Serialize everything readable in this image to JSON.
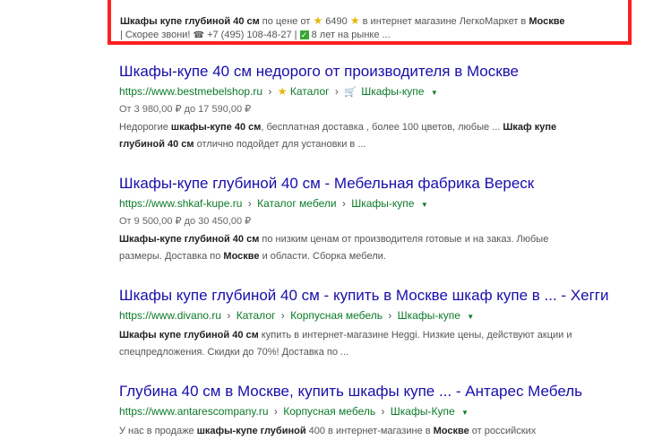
{
  "ad": {
    "line1": {
      "b1": "Шкафы купе глубиной 40 см",
      "t1": " по цене от ",
      "price": "6490",
      "t2": " в интернет магазине ЛегкоМаркет в ",
      "b2": "Москве"
    },
    "line2": {
      "t1": "| Скорее звони! ",
      "phone": "+7 (495) 108-48-27",
      "t2": " | ",
      "t3": " 8 лет на рынке ..."
    }
  },
  "results": [
    {
      "title": "Шкафы-купе 40 см недорого от производителя в Москве",
      "url": "https://www.bestmebelshop.ru",
      "crumbs": [
        "Каталог",
        "Шкафы-купе"
      ],
      "price": "От 3 980,00 ₽ до 17 590,00 ₽",
      "snip": {
        "t1": "Недорогие ",
        "b1": "шкафы-купе 40 см",
        "t2": ", бесплатная доставка , более 100 цветов, любые ... ",
        "b2": "Шкаф купе",
        "b3": "глубиной 40 см",
        "t3": " отлично подойдет для установки в ..."
      }
    },
    {
      "title": "Шкафы-купе глубиной 40 см - Мебельная фабрика Вереск",
      "url": "https://www.shkaf-kupe.ru",
      "crumbs": [
        "Каталог мебели",
        "Шкафы-купе"
      ],
      "price": "От 9 500,00 ₽ до 30 450,00 ₽",
      "snip": {
        "b1": "Шкафы-купе глубиной 40 см",
        "t1": " по низким ценам от производителя готовые и на заказ. Любые",
        "t2": "размеры. Доставка по ",
        "b2": "Москве",
        "t3": " и области. Сборка мебели."
      }
    },
    {
      "title": "Шкафы купе глубиной 40 см - купить в Москве шкаф купе в ... - Хегги",
      "url": "https://www.divano.ru",
      "crumbs": [
        "Каталог",
        "Корпусная мебель",
        "Шкафы-купе"
      ],
      "snip": {
        "b1": "Шкафы купе глубиной 40 см",
        "t1": " купить в интернет-магазине Heggi. Низкие цены, действуют акции и",
        "t2": "спецпредложения. Скидки до 70%! Доставка по ..."
      }
    },
    {
      "title": "Глубина 40 см в Москве, купить шкафы купе ... - Антарес Мебель",
      "url": "https://www.antarescompany.ru",
      "crumbs": [
        "Корпусная мебель",
        "Шкафы-Купе"
      ],
      "snip": {
        "t1": "У нас в продаже ",
        "b1": "шкафы-купе глубиной",
        "t2": " 400 в интернет-магазине в ",
        "b2": "Москве",
        "t3": " от российских"
      }
    }
  ]
}
